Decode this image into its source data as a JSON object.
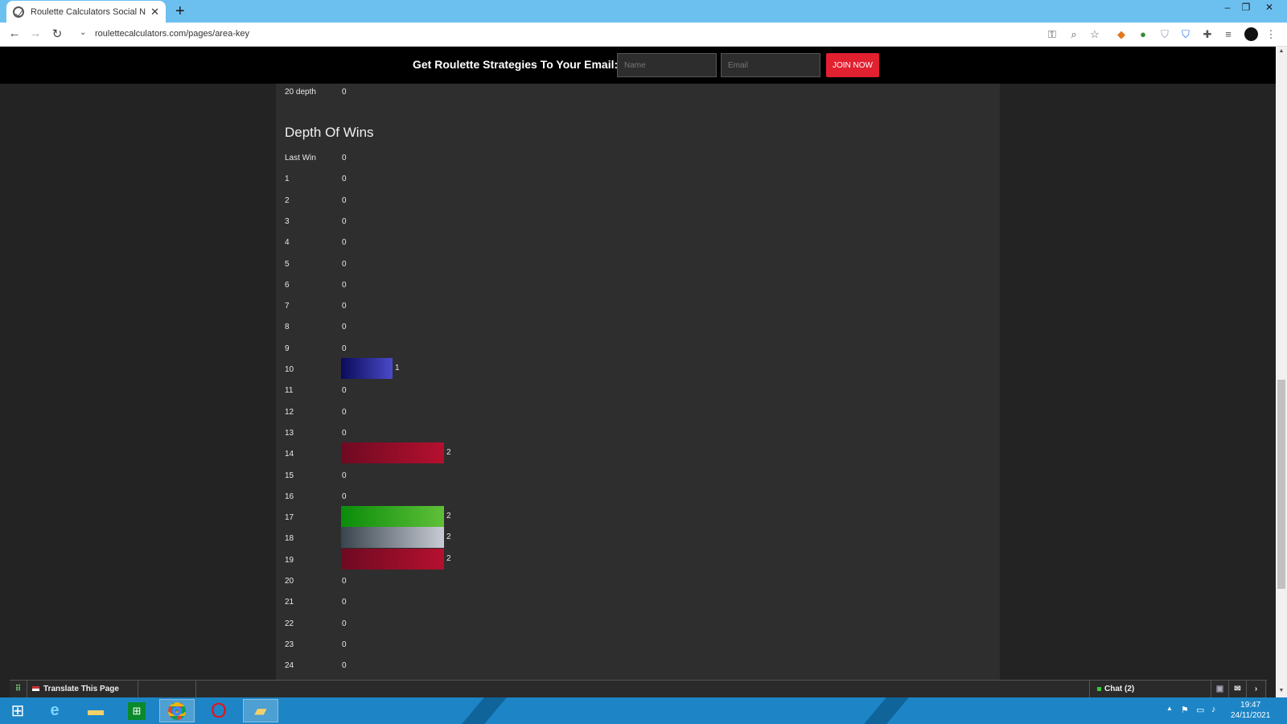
{
  "browser": {
    "tab_title": "Roulette Calculators Social Netw",
    "tab_close": "✕",
    "new_tab": "+",
    "url": "roulettecalculators.com/pages/area-key"
  },
  "promo": {
    "text": "Get Roulette Strategies To Your Email:",
    "name_placeholder": "Name",
    "email_placeholder": "Email",
    "button": "JOIN NOW"
  },
  "top_row": {
    "label": "20 depth",
    "value": "0"
  },
  "depth_of_wins": {
    "heading": "Depth Of Wins",
    "rows": [
      {
        "label": "Last Win",
        "value": "0"
      },
      {
        "label": "1",
        "value": "0"
      },
      {
        "label": "2",
        "value": "0"
      },
      {
        "label": "3",
        "value": "0"
      },
      {
        "label": "4",
        "value": "0"
      },
      {
        "label": "5",
        "value": "0"
      },
      {
        "label": "6",
        "value": "0"
      },
      {
        "label": "7",
        "value": "0"
      },
      {
        "label": "8",
        "value": "0"
      },
      {
        "label": "9",
        "value": "0"
      },
      {
        "label": "10",
        "value": "1"
      },
      {
        "label": "11",
        "value": "0"
      },
      {
        "label": "12",
        "value": "0"
      },
      {
        "label": "13",
        "value": "0"
      },
      {
        "label": "14",
        "value": "2"
      },
      {
        "label": "15",
        "value": "0"
      },
      {
        "label": "16",
        "value": "0"
      },
      {
        "label": "17",
        "value": "2"
      },
      {
        "label": "18",
        "value": "2"
      },
      {
        "label": "19",
        "value": "2"
      },
      {
        "label": "20",
        "value": "0"
      },
      {
        "label": "21",
        "value": "0"
      },
      {
        "label": "22",
        "value": "0"
      },
      {
        "label": "23",
        "value": "0"
      },
      {
        "label": "24",
        "value": "0"
      }
    ],
    "bar_colors": {
      "10": [
        "#0a0a5a",
        "#4a4ac8"
      ],
      "14": [
        "#6e0a22",
        "#b5102e"
      ],
      "17": [
        "#0a8c0a",
        "#5fc038"
      ],
      "18": [
        "#3a444e",
        "#c8ccd4"
      ],
      "19": [
        "#6e0a22",
        "#b5102e"
      ]
    }
  },
  "sitebar": {
    "translate": "Translate This Page",
    "chat": "Chat (2)"
  },
  "taskbar": {
    "time": "19:47",
    "date": "24/11/2021"
  }
}
